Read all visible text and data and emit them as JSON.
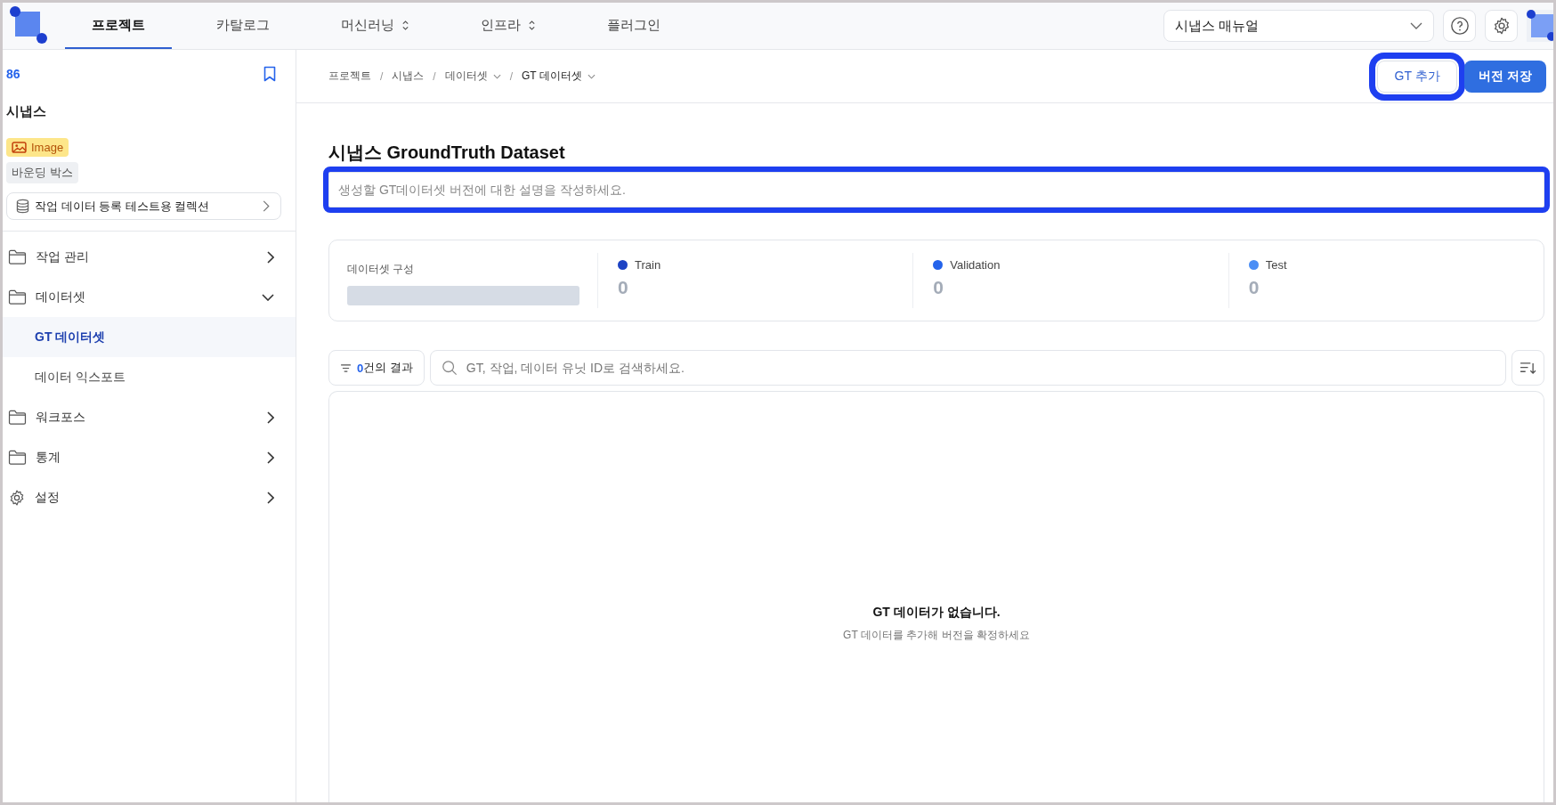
{
  "topnav": {
    "tabs": [
      {
        "label": "프로젝트",
        "selected": true,
        "dropdown": false
      },
      {
        "label": "카탈로그",
        "selected": false,
        "dropdown": false
      },
      {
        "label": "머신러닝",
        "selected": false,
        "dropdown": true
      },
      {
        "label": "인프라",
        "selected": false,
        "dropdown": true
      },
      {
        "label": "플러그인",
        "selected": false,
        "dropdown": false
      }
    ],
    "manual_select": {
      "value": "시냅스 매뉴얼"
    }
  },
  "sidebar": {
    "project_id": "86",
    "project_name": "시냅스",
    "data_type": "Image",
    "annotation_type": "바운딩 박스",
    "collection": "작업 데이터 등록 테스트용 컬렉션",
    "items": [
      {
        "label": "작업 관리",
        "kind": "folder",
        "expanded": false
      },
      {
        "label": "데이터셋",
        "kind": "folder",
        "expanded": true,
        "children": [
          {
            "label": "GT 데이터셋",
            "selected": true
          },
          {
            "label": "데이터 익스포트",
            "selected": false
          }
        ]
      },
      {
        "label": "워크포스",
        "kind": "folder",
        "expanded": false
      },
      {
        "label": "통계",
        "kind": "folder",
        "expanded": false
      },
      {
        "label": "설정",
        "kind": "settings",
        "expanded": false
      }
    ]
  },
  "breadcrumb": [
    {
      "label": "프로젝트",
      "dropdown": false,
      "current": false
    },
    {
      "separator": "/",
      "label": "시냅스",
      "dropdown": false,
      "current": false
    },
    {
      "separator": "/",
      "label": "데이터셋",
      "dropdown": true,
      "current": false
    },
    {
      "separator": "/",
      "label": "GT 데이터셋",
      "dropdown": true,
      "current": true
    }
  ],
  "actions": [
    {
      "label": "GT 추가",
      "kind": "secondary",
      "highlighted": true
    },
    {
      "label": "버전 저장",
      "kind": "primary",
      "highlighted": false
    }
  ],
  "title": "시냅스 GroundTruth Dataset",
  "description_field": {
    "placeholder": "생성할 GT데이터셋 버전에 대한 설명을 작성하세요.",
    "highlighted": true
  },
  "composition": {
    "label": "데이터셋 구성",
    "splits": [
      {
        "name": "Train",
        "count": "0",
        "color": "#1d43c4"
      },
      {
        "name": "Validation",
        "count": "0",
        "color": "#2463eb"
      },
      {
        "name": "Test",
        "count": "0",
        "color": "#4b8ef5"
      }
    ]
  },
  "results": {
    "count": "0",
    "label": "건의 결과"
  },
  "search": {
    "placeholder": "GT, 작업, 데이터 유닛 ID로 검색하세요."
  },
  "empty_state": {
    "title": "GT 데이터가 없습니다.",
    "message": "GT 데이터를 추가해 버전을 확정하세요"
  }
}
